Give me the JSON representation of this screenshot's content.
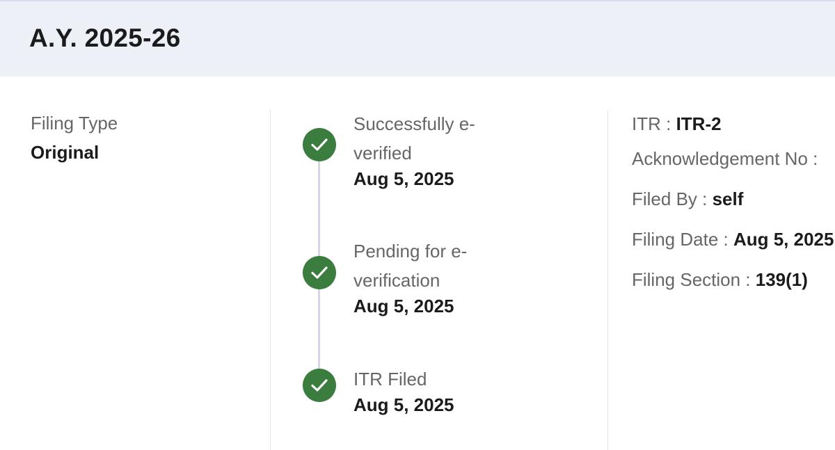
{
  "header": {
    "title": "A.Y. 2025-26"
  },
  "filing": {
    "type_label": "Filing Type",
    "type_value": "Original"
  },
  "timeline": {
    "steps": [
      {
        "label": "Successfully e-verified",
        "date": "Aug 5, 2025",
        "icon": "check-icon",
        "status": "complete"
      },
      {
        "label": "Pending for e-verification",
        "date": "Aug 5, 2025",
        "icon": "check-icon",
        "status": "complete"
      },
      {
        "label": "ITR Filed",
        "date": "Aug 5, 2025",
        "icon": "check-icon",
        "status": "complete"
      }
    ],
    "complete_color": "#3a7d3e"
  },
  "details": {
    "itr_label": "ITR : ",
    "itr_value": "ITR-2",
    "ack_label": "Acknowledgement No : ",
    "ack_value": "",
    "filed_by_label": "Filed By : ",
    "filed_by_value": "self",
    "filing_date_label": "Filing Date : ",
    "filing_date_value": "Aug 5, 2025",
    "filing_section_label": "Filing Section : ",
    "filing_section_value": "139(1)"
  }
}
